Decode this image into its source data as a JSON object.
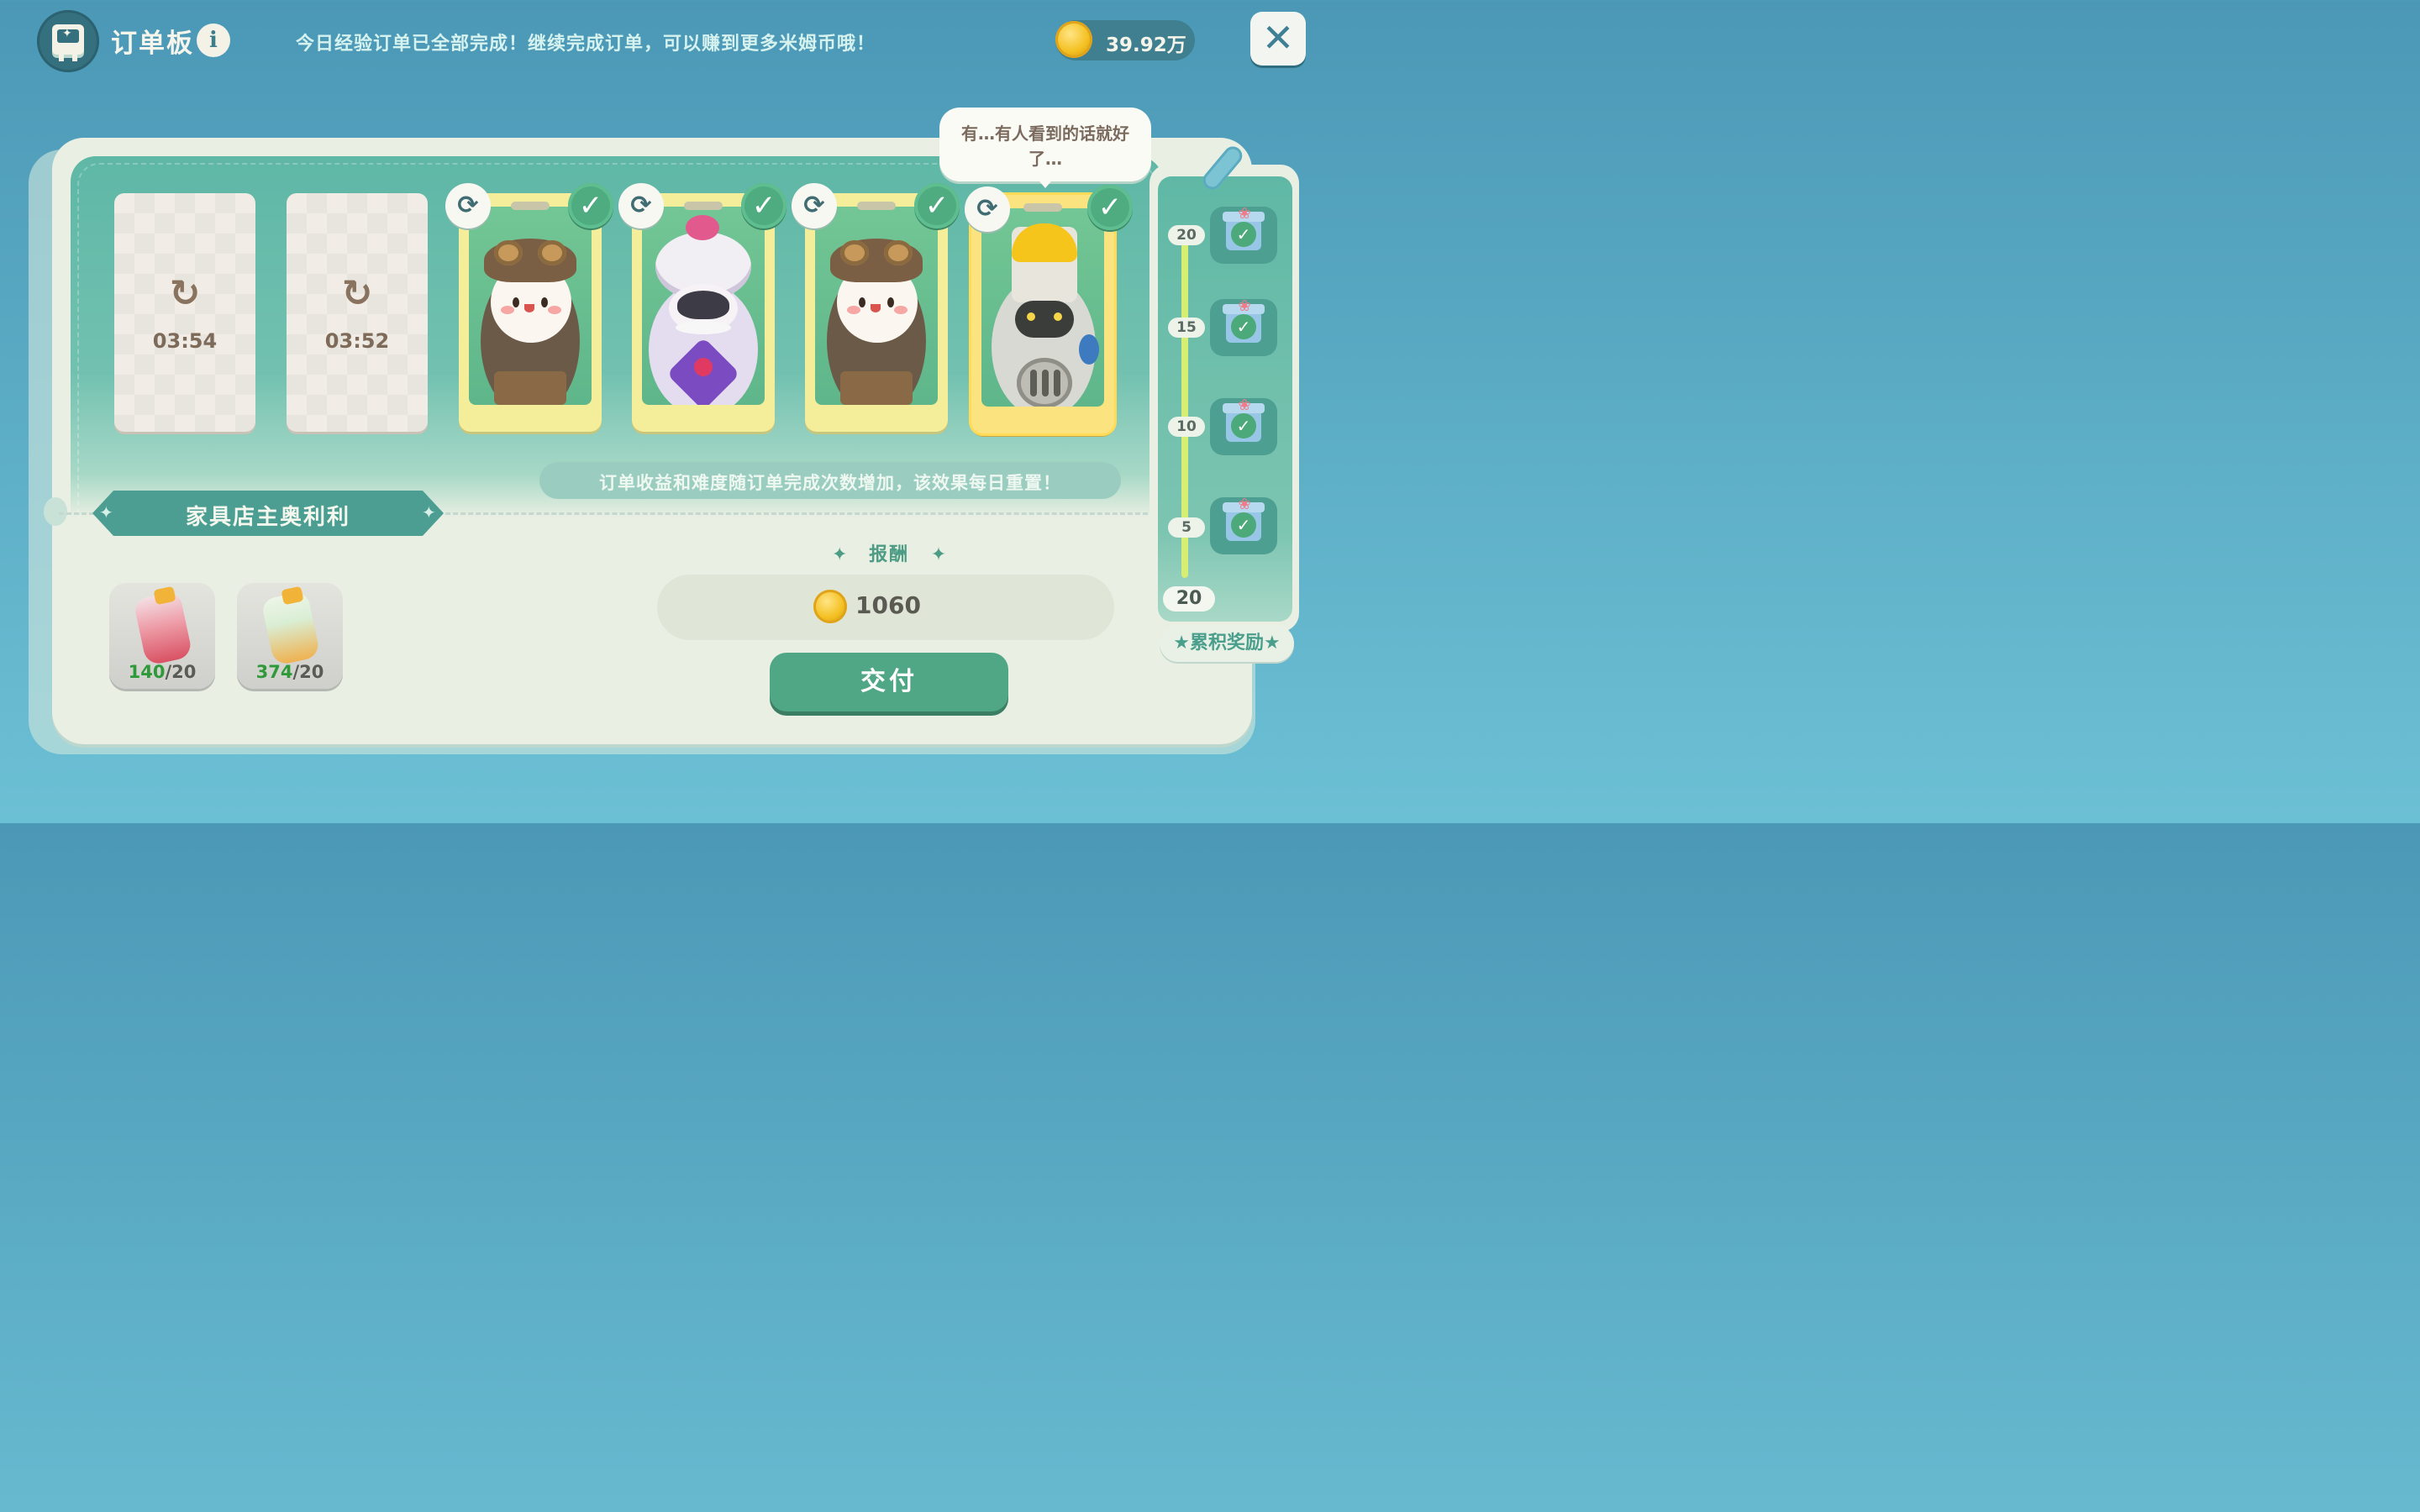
{
  "header": {
    "title": "订单板",
    "info_icon": "i",
    "notice": "今日经验订单已全部完成！继续完成订单，可以赚到更多米姆币哦！",
    "currency_amount": "39.92万",
    "close_icon": "✕"
  },
  "order_slots": [
    {
      "type": "cooldown",
      "timer": "03:54"
    },
    {
      "type": "cooldown",
      "timer": "03:52"
    },
    {
      "type": "character",
      "character": "pilot-goggles",
      "completed": true
    },
    {
      "type": "character",
      "character": "purple-chef",
      "completed": true
    },
    {
      "type": "character",
      "character": "pilot-goggles",
      "completed": true
    },
    {
      "type": "character",
      "character": "paint-bucket-robot",
      "completed": true,
      "selected": true
    }
  ],
  "icons": {
    "refresh": "↻",
    "swap": "⟳",
    "check": "✓",
    "star": "✦",
    "gift": "gift-icon"
  },
  "speech_bubble": "有…有人看到的话就好了…",
  "hint_banner": "订单收益和难度随订单完成次数增加，该效果每日重置！",
  "customer_name": "家具店主奥利利",
  "required_items": [
    {
      "name": "red-potion-bottle",
      "have": "140",
      "need": "/20"
    },
    {
      "name": "orange-jar",
      "have": "374",
      "need": "/20"
    }
  ],
  "reward": {
    "title": "报酬",
    "coins": "1060",
    "deliver_label": "交付"
  },
  "progress": {
    "milestones": [
      "20",
      "15",
      "10",
      "5"
    ],
    "milestones_claimed": [
      true,
      true,
      true,
      true
    ],
    "total_completed": "20",
    "cumulative_label": "累积奖励"
  },
  "colors": {
    "accent_green": "#4fa785",
    "teal_bg": "#4b98b6",
    "card_yellow": "#f4ee9a",
    "coin_gold": "#f4c021"
  }
}
